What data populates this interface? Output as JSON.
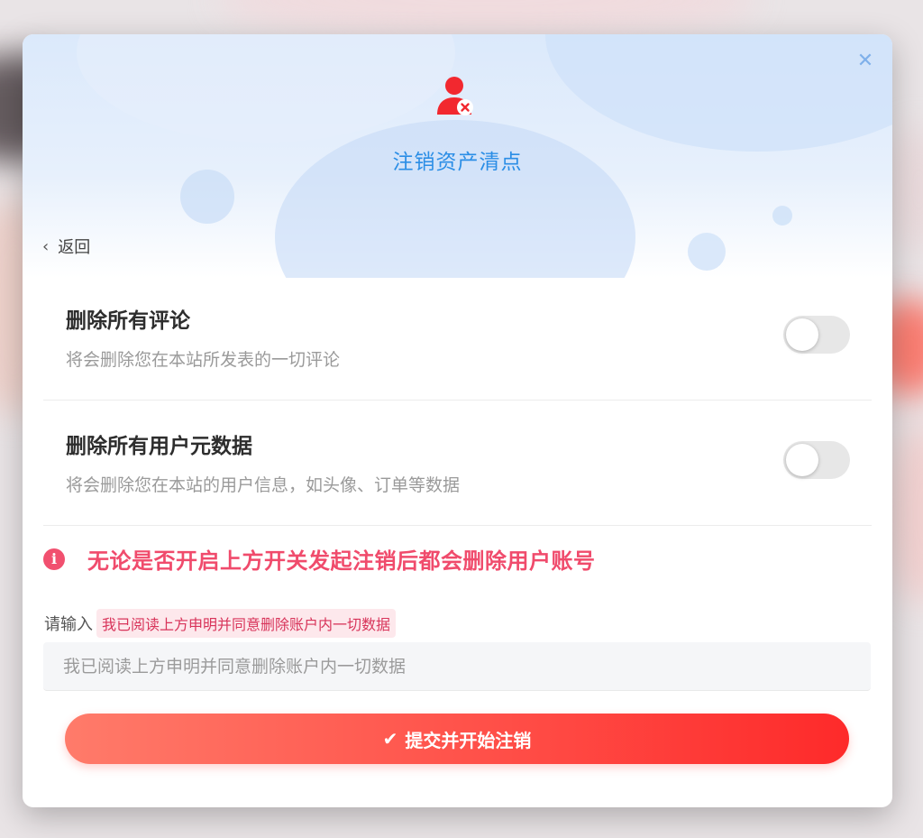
{
  "modal": {
    "title": "注销资产清点",
    "close_icon": "close-icon",
    "header_icon": "user-remove-icon",
    "back": {
      "label": "返回",
      "icon": "chevron-left-icon"
    }
  },
  "options": [
    {
      "title": "删除所有评论",
      "description": "将会删除您在本站所发表的一切评论",
      "enabled": false
    },
    {
      "title": "删除所有用户元数据",
      "description": "将会删除您在本站的用户信息，如头像、订单等数据",
      "enabled": false
    }
  ],
  "warning": {
    "icon": "info-icon",
    "text": "无论是否开启上方开关发起注销后都会删除用户账号"
  },
  "confirm": {
    "label": "请输入",
    "phrase": "我已阅读上方申明并同意删除账户内一切数据",
    "placeholder": "我已阅读上方申明并同意删除账户内一切数据",
    "value": ""
  },
  "submit": {
    "label": "提交并开始注销",
    "icon": "check-icon"
  },
  "colors": {
    "accent_blue": "#2b8ee6",
    "warning_red": "#f04b6c",
    "button_gradient_start": "#ff7b6a",
    "button_gradient_end": "#fe2a2a",
    "icon_red": "#f2282f"
  }
}
